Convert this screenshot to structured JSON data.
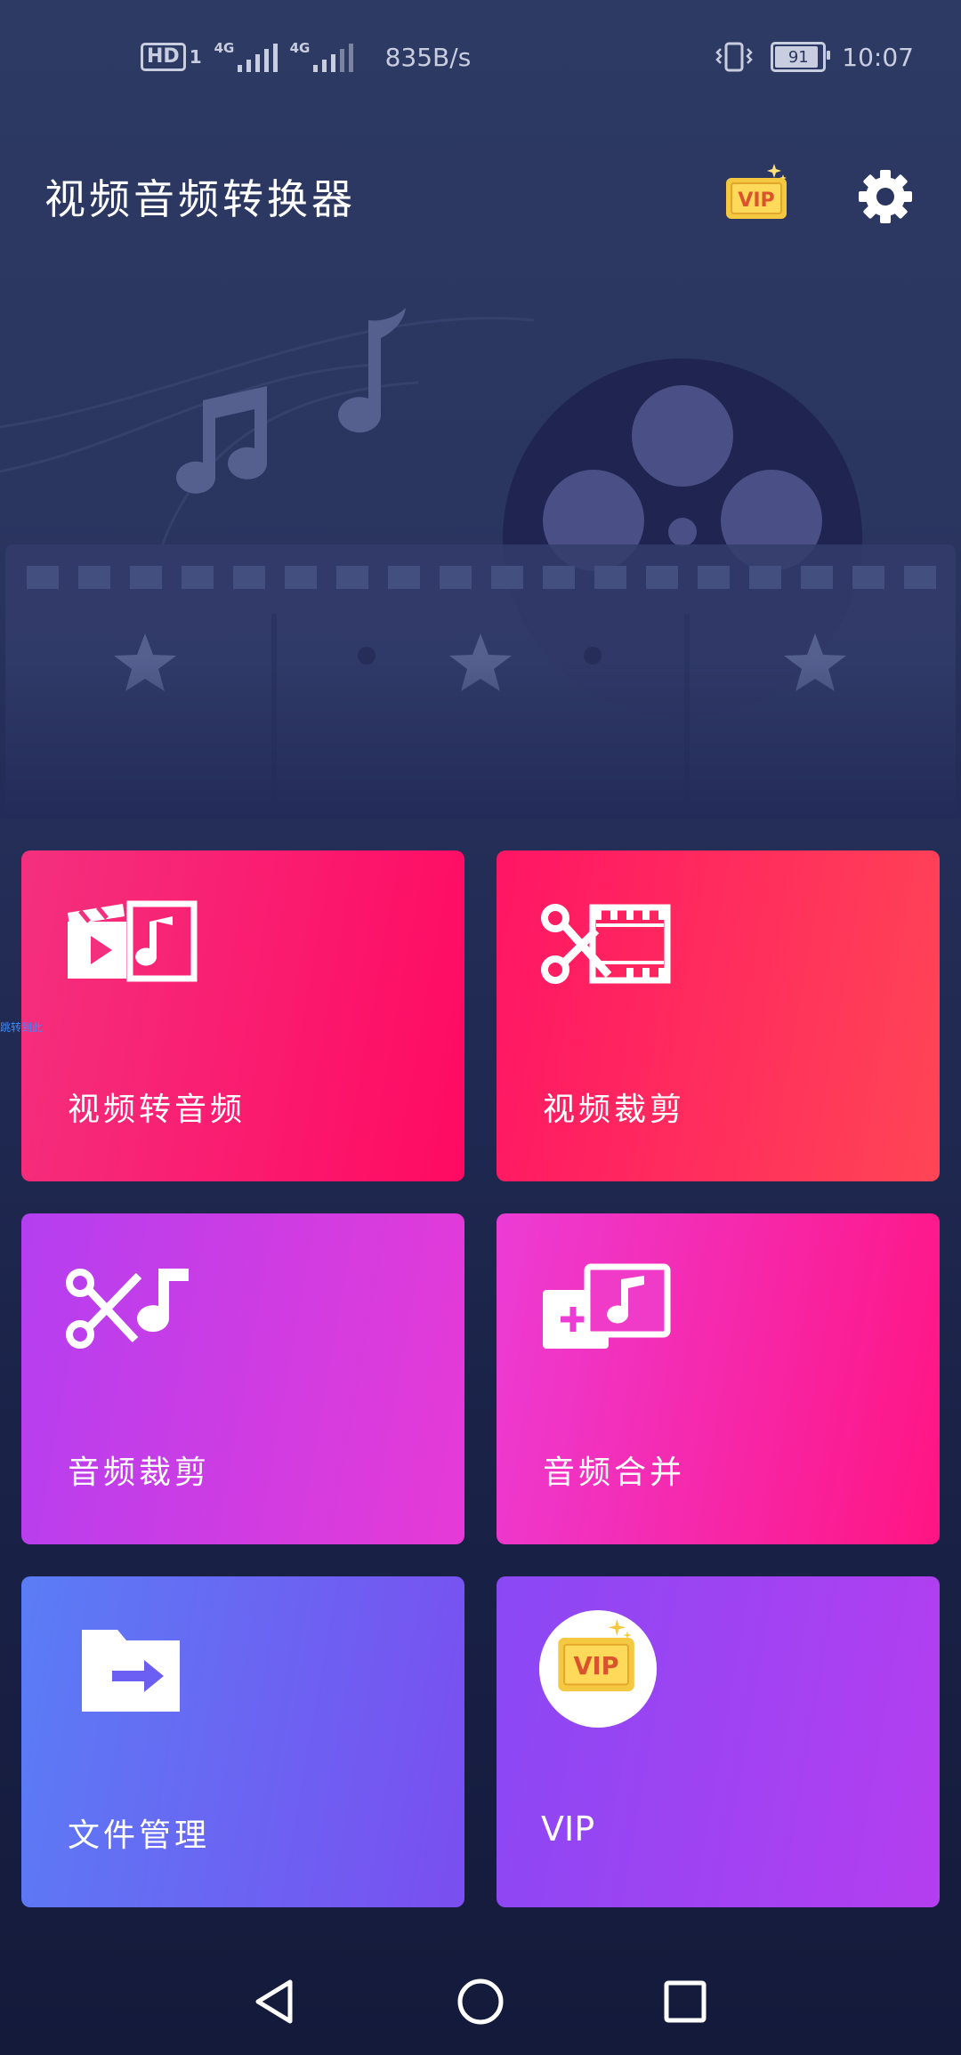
{
  "status_bar": {
    "hd_label": "HD",
    "sim_slot": "1",
    "signal1_label": "4G",
    "signal2_label": "4G",
    "net_speed": "835B/s",
    "battery_level": "91",
    "time": "10:07"
  },
  "header": {
    "title": "视频音频转换器",
    "vip_badge": "VIP"
  },
  "features": [
    {
      "label": "视频转音频",
      "icon": "video-to-audio-icon"
    },
    {
      "label": "视频裁剪",
      "icon": "video-cut-icon"
    },
    {
      "label": "音频裁剪",
      "icon": "audio-cut-icon"
    },
    {
      "label": "音频合并",
      "icon": "audio-merge-icon"
    },
    {
      "label": "文件管理",
      "icon": "folder-move-icon"
    },
    {
      "label": "VIP",
      "icon": "vip-icon",
      "badge": "VIP"
    }
  ],
  "overlay": {
    "text": "跳转到此"
  },
  "colors": {
    "background": "#2a3560",
    "card1": "#ff0a62",
    "card2": "#ff2e5e",
    "card3": "#c83ee4",
    "card4": "#f82aa0",
    "card5": "#6a66f2",
    "card6": "#9c44f2",
    "vip_gold": "#f5c842"
  }
}
